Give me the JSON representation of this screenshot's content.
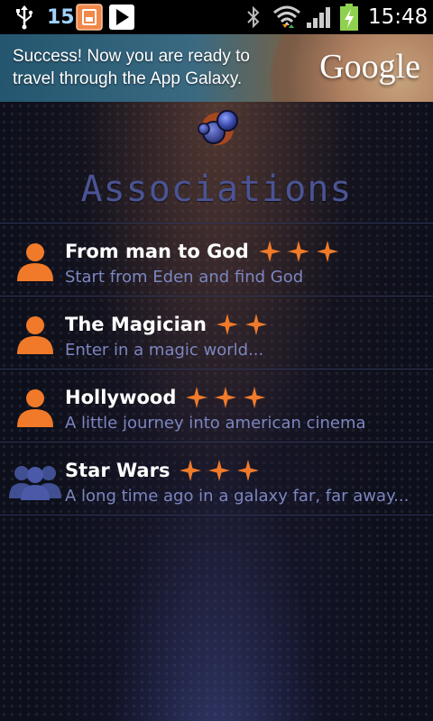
{
  "status_bar": {
    "temperature": "15°",
    "time": "15:48",
    "icons": [
      "usb-icon",
      "thermometer-app-icon",
      "play-store-icon",
      "bluetooth-icon",
      "wifi-icon",
      "signal-icon",
      "battery-charging-icon"
    ]
  },
  "ad": {
    "line1": "Success! Now you are ready to",
    "line2": "travel through the App Galaxy.",
    "brand": "Google"
  },
  "page": {
    "title": "Associations"
  },
  "list": [
    {
      "title": "From man to God",
      "subtitle": "Start from Eden and find God",
      "stars": 3,
      "icon": "single-user-icon",
      "icon_color": "#f07a2a"
    },
    {
      "title": "The Magician",
      "subtitle": "Enter in a magic world...",
      "stars": 2,
      "icon": "single-user-icon",
      "icon_color": "#f07a2a"
    },
    {
      "title": "Hollywood",
      "subtitle": "A little journey into american cinema",
      "stars": 3,
      "icon": "single-user-icon",
      "icon_color": "#f07a2a"
    },
    {
      "title": "Star Wars",
      "subtitle": "A long time ago in a galaxy far, far away...",
      "stars": 3,
      "icon": "group-users-icon",
      "icon_color": "#4a5aa8"
    }
  ],
  "colors": {
    "accent_orange": "#f07a2a",
    "title_blue": "#4a5494",
    "subtitle_blue": "#7d86c0"
  }
}
